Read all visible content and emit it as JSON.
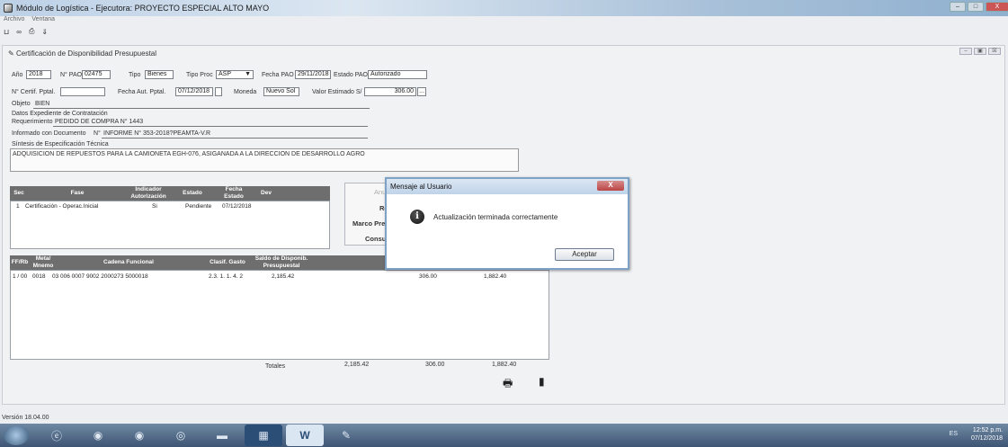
{
  "window": {
    "title": "Módulo de Logística - Ejecutora: PROYECTO ESPECIAL ALTO MAYO",
    "minimize": "–",
    "maximize": "□",
    "close": "X"
  },
  "menu": [
    "Archivo",
    "Ventana"
  ],
  "toolbar": [
    "⊔",
    "∞",
    "⎙",
    "⇓"
  ],
  "form": {
    "title": "Certificación de Disponibilidad Presupuestal",
    "ctl": [
      "–",
      "▣",
      "☒"
    ],
    "anio_label": "Año",
    "anio": "2018",
    "npao_label": "N° PAO",
    "npao": "02475",
    "tipo_label": "Tipo",
    "tipo": "Bienes",
    "tipoproc_label": "Tipo Proc",
    "tipoproc": "ASP",
    "fechapao_label": "Fecha PAO",
    "fechapao": "29/11/2018",
    "estadopao_label": "Estado PAO",
    "estadopao": "Autorizado",
    "ncert_label": "N° Certif. Pptal.",
    "ncert": "",
    "fechaaut_label": "Fecha Aut. Pptal.",
    "fechaaut": "07/12/2018",
    "moneda_label": "Moneda",
    "moneda": "Nuevo Sol",
    "valor_label": "Valor Estimado S/",
    "valor": "306.00",
    "valor_btn": "...",
    "objeto_label": "Objeto",
    "objeto": "BIEN",
    "datos_label": "Datos Expediente de Contratación",
    "requerimiento_label": "Requerimiento",
    "requerimiento": "PEDIDO DE COMPRA N° 1443",
    "informado_label": "Informado con Documento",
    "informado_n_label": "N°",
    "informado": "INFORME N° 353-2018?PEAMTA-V.R",
    "sintesis_label": "Síntesis de Especificación Técnica",
    "sintesis": "ADQUISICION DE REPUESTOS PARA LA CAMIONETA EGH-076, ASIGANADA A LA DIRECCION DE DESARROLLO AGRO"
  },
  "grid1": {
    "headers": [
      "Sec",
      "Fase",
      "Indicador Autorización",
      "Estado",
      "Fecha Estado",
      "Dev"
    ],
    "rows": [
      {
        "sec": "1",
        "fase": "Certificación - Operac.Inicial",
        "indicador": "Si",
        "estado": "Pendiente",
        "fecha": "07/12/2018",
        "dev": ""
      }
    ]
  },
  "sidepanel": {
    "items": [
      "Anu",
      "Rev",
      "Marco Pre",
      "Consu"
    ]
  },
  "grid2": {
    "headers": [
      "FF/Rb",
      "Meta/ Mnemo",
      "Cadena Funcional",
      "Clasif. Gasto",
      "Saldo de Disponib. Presupuestal",
      "",
      "",
      ""
    ],
    "rows": [
      {
        "ff": "1 / 00",
        "meta": "0018",
        "cadena": "03 006 0007 9002 2000273 5000018",
        "clasif": "2.3. 1. 1. 4. 2",
        "saldo": "2,185.42",
        "c6": "306.00",
        "c7": "1,882.40"
      }
    ],
    "totals_label": "Totales",
    "totals": [
      "2,185.42",
      "306.00",
      "1,882.40"
    ]
  },
  "dialog": {
    "title": "Mensaje al Usuario",
    "close": "X",
    "message": "Actualización terminada correctamente",
    "icon": "i",
    "ok": "Aceptar"
  },
  "status": {
    "version": "Versión 18.04.00"
  },
  "taskbar": {
    "items": [
      "start-orb",
      "browser-e",
      "chrome",
      "chrome-2",
      "folder",
      "explorer",
      "app-siga",
      "word",
      "app-pen"
    ],
    "lang": "ES",
    "time": "12:52 p.m.",
    "date": "07/12/2018"
  }
}
